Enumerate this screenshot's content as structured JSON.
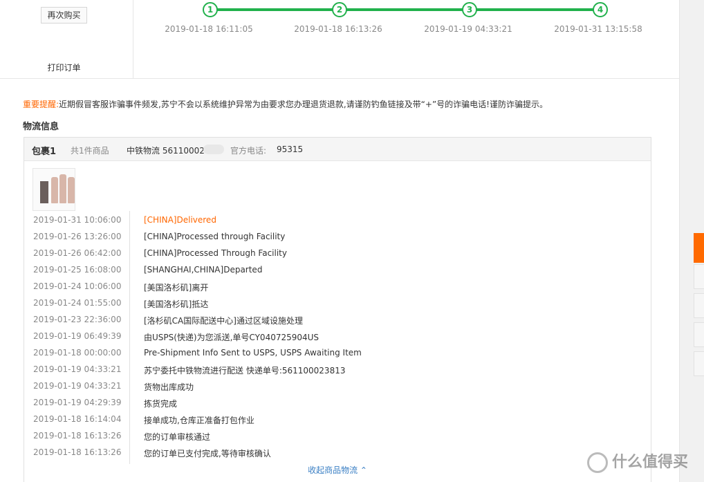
{
  "order_actions": {
    "rebuy_label": "再次购买",
    "print_label": "打印订单"
  },
  "progress": {
    "steps": [
      {
        "number": "1",
        "time": "2019-01-18 16:11:05"
      },
      {
        "number": "2",
        "time": "2019-01-18 16:13:26"
      },
      {
        "number": "3",
        "time": "2019-01-19 04:33:21"
      },
      {
        "number": "4",
        "time": "2019-01-31 13:15:58"
      }
    ],
    "color": "#21b14c"
  },
  "notice": {
    "label": "重要提醒:",
    "text": "近期假冒客服诈骗事件频发,苏宁不会以系统维护异常为由要求您办理退货退款,请谨防钓鱼链接及带“+”号的诈骗电话!谨防诈骗提示。"
  },
  "logistics": {
    "title": "物流信息",
    "package_name": "包裹1",
    "item_count": "共1件商品",
    "carrier": "中铁物流  56110002",
    "phone_label": "官方电话:",
    "phone": "95315",
    "product_thumb_icon": "product-image-icon",
    "events": [
      {
        "time": "2019-01-31 10:06:00",
        "desc": "[CHINA]Delivered"
      },
      {
        "time": "2019-01-26 13:26:00",
        "desc": "[CHINA]Processed through Facility"
      },
      {
        "time": "2019-01-26 06:42:00",
        "desc": "[CHINA]Processed Through Facility"
      },
      {
        "time": "2019-01-25 16:08:00",
        "desc": "[SHANGHAI,CHINA]Departed"
      },
      {
        "time": "2019-01-24 10:06:00",
        "desc": "[美国洛杉矶]离开"
      },
      {
        "time": "2019-01-24 01:55:00",
        "desc": "[美国洛杉矶]抵达"
      },
      {
        "time": "2019-01-23 22:36:00",
        "desc": "[洛杉矶CA国际配送中心]通过区域设施处理"
      },
      {
        "time": "2019-01-19 06:49:39",
        "desc": "由USPS(快递)为您派送,单号CY040725904US"
      },
      {
        "time": "2019-01-18 00:00:00",
        "desc": "Pre-Shipment Info Sent to USPS, USPS Awaiting Item"
      },
      {
        "time": "2019-01-19 04:33:21",
        "desc": "苏宁委托中铁物流进行配送 快递单号:561100023813"
      },
      {
        "time": "2019-01-19 04:33:21",
        "desc": "货物出库成功"
      },
      {
        "time": "2019-01-19 04:29:39",
        "desc": "拣货完成"
      },
      {
        "time": "2019-01-18 16:14:04",
        "desc": "接单成功,仓库正准备打包作业"
      },
      {
        "time": "2019-01-18 16:13:26",
        "desc": "您的订单审核通过"
      },
      {
        "time": "2019-01-18 16:13:26",
        "desc": "您的订单已支付完成,等待审核确认"
      }
    ],
    "collapse_label": "收起商品物流 ⌃"
  },
  "watermark": {
    "text": "什么值得买"
  },
  "colors": {
    "accent_orange": "#ff6600",
    "link_blue": "#3a7fc4"
  }
}
